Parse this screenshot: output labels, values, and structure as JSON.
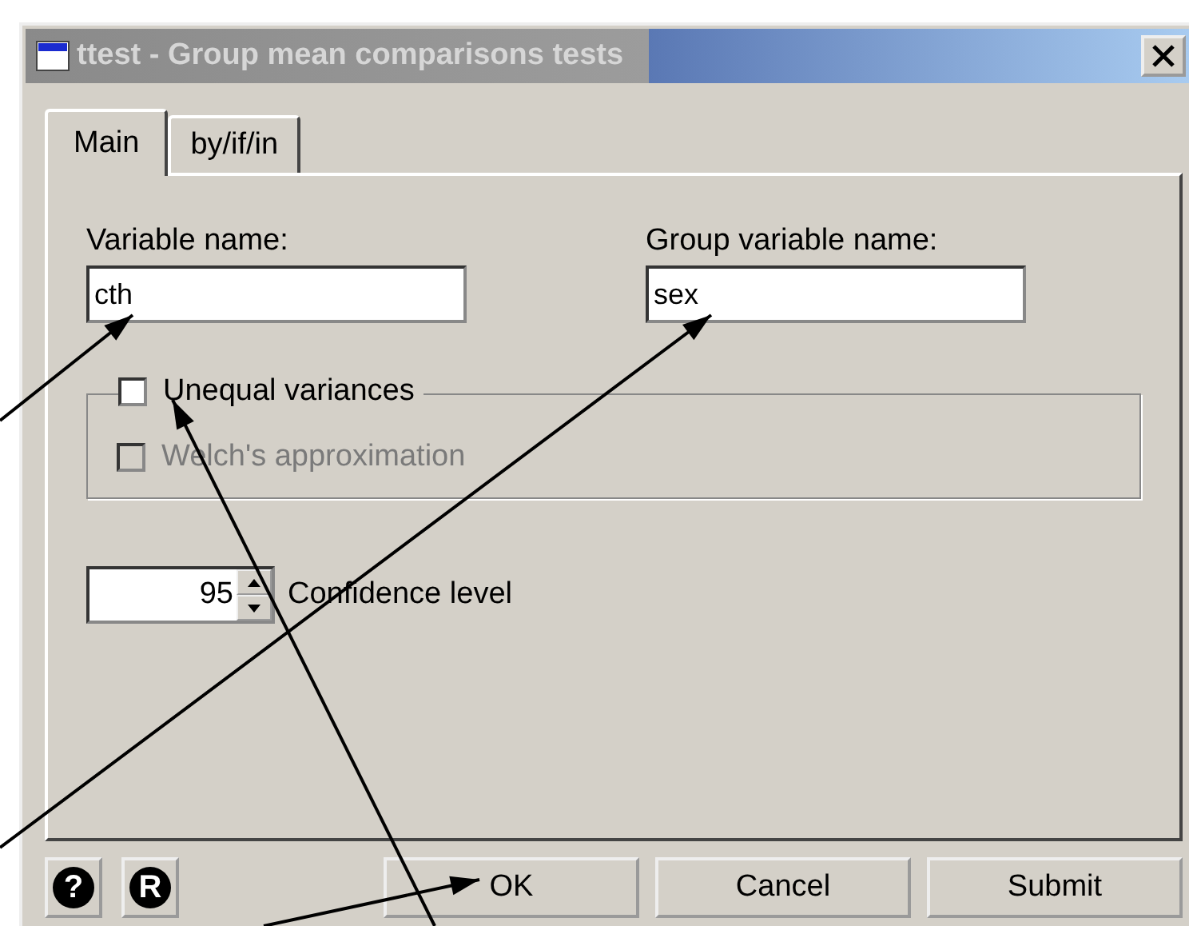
{
  "window": {
    "title": "ttest - Group mean comparisons tests"
  },
  "tabs": [
    {
      "label": "Main",
      "selected": true
    },
    {
      "label": "by/if/in",
      "selected": false
    }
  ],
  "fields": [
    {
      "label": "Variable name:",
      "value": "cth"
    },
    {
      "label": "Group variable name:",
      "value": "sex"
    }
  ],
  "options": [
    {
      "label": "Unequal variances",
      "checked": false,
      "disabled": false
    },
    {
      "label": "Welch's approximation",
      "checked": false,
      "disabled": true
    }
  ],
  "confidence": {
    "value": "95",
    "label": "Confidence level"
  },
  "help_buttons": [
    "?",
    "R"
  ],
  "buttons": [
    "OK",
    "Cancel",
    "Submit"
  ]
}
